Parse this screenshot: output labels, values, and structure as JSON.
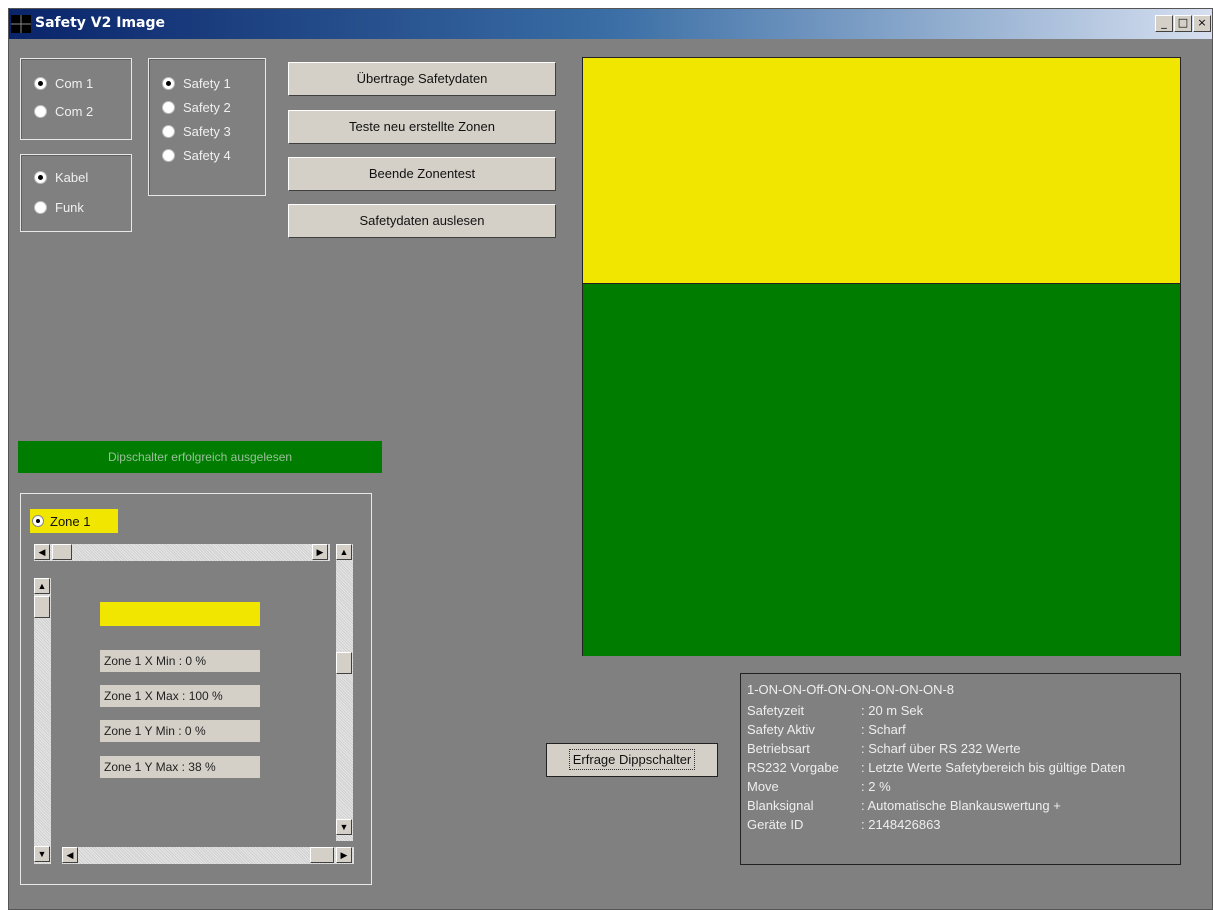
{
  "window": {
    "title": "Safety V2 Image",
    "controls": [
      "_",
      "□",
      "×"
    ]
  },
  "port_group": [
    {
      "label": "Com 1",
      "checked": true
    },
    {
      "label": "Com 2",
      "checked": false
    }
  ],
  "link_group": [
    {
      "label": "Kabel",
      "checked": true
    },
    {
      "label": "Funk",
      "checked": false
    }
  ],
  "safety_group": [
    {
      "label": "Safety 1",
      "checked": true
    },
    {
      "label": "Safety 2",
      "checked": false
    },
    {
      "label": "Safety 3",
      "checked": false
    },
    {
      "label": "Safety 4",
      "checked": false
    }
  ],
  "actions": {
    "transfer": "Übertrage Safetydaten",
    "test": "Teste neu erstellte Zonen",
    "end_test": "Beende Zonentest",
    "read": "Safetydaten auslesen"
  },
  "status": "Dipschalter erfolgreich ausgelesen",
  "zone": {
    "label": "Zone 1",
    "x_min": "Zone 1 X Min : 0 %",
    "x_max": "Zone 1 X Max : 100 %",
    "y_min": "Zone 1 Y Min : 0 %",
    "y_max": "Zone 1 Y Max : 38 %"
  },
  "query_button": "Erfrage Dippschalter",
  "info": {
    "header": "1-ON-ON-Off-ON-ON-ON-ON-ON-8",
    "rows": [
      {
        "k": "Safetyzeit",
        "v": ": 20 m Sek"
      },
      {
        "k": "Safety Aktiv",
        "v": ": Scharf"
      },
      {
        "k": "Betriebsart",
        "v": ": Scharf über RS 232 Werte"
      },
      {
        "k": "RS232 Vorgabe",
        "v": ": Letzte Werte Safetybereich bis gültige Daten"
      },
      {
        "k": "Move",
        "v": ": 2 %"
      },
      {
        "k": "Blanksignal",
        "v": ": Automatische Blankauswertung +"
      },
      {
        "k": "Geräte ID",
        "v": ": 2148426863"
      }
    ]
  },
  "colors": {
    "zone_yellow": "#f0e600",
    "zone_green": "#007d00",
    "background": "#808080"
  }
}
